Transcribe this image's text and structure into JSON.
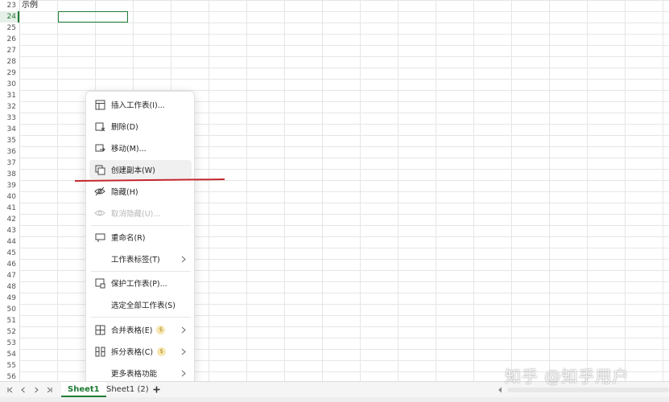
{
  "grid": {
    "rows": [
      "23",
      "24",
      "25",
      "26",
      "27",
      "28",
      "29",
      "30",
      "31",
      "32",
      "33",
      "34",
      "35",
      "36",
      "37",
      "38",
      "39",
      "40",
      "41",
      "42",
      "43",
      "44",
      "45",
      "46",
      "47",
      "48",
      "49",
      "50",
      "51",
      "52",
      "53",
      "54",
      "55",
      "56"
    ],
    "active_row": "24",
    "cell_a23_text": "示例"
  },
  "context_menu": {
    "items": [
      {
        "label": "插入工作表(I)...",
        "icon": "insert-sheet-icon"
      },
      {
        "label": "删除(D)",
        "icon": "delete-sheet-icon"
      },
      {
        "label": "移动(M)...",
        "icon": "move-sheet-icon"
      },
      {
        "label": "创建副本(W)",
        "icon": "copy-sheet-icon",
        "hovered": true
      },
      {
        "label": "隐藏(H)",
        "icon": "hide-eye-icon"
      },
      {
        "label": "取消隐藏(U)...",
        "icon": "unhide-eye-icon",
        "disabled": true
      },
      {
        "label": "重命名(R)",
        "icon": "rename-icon"
      },
      {
        "label": "工作表标签(T)",
        "icon": "",
        "submenu": true
      },
      {
        "label": "保护工作表(P)...",
        "icon": "protect-sheet-icon"
      },
      {
        "label": "选定全部工作表(S)",
        "icon": ""
      },
      {
        "label": "合并表格(E)",
        "icon": "merge-table-icon",
        "premium": true,
        "submenu": true
      },
      {
        "label": "拆分表格(C)",
        "icon": "split-table-icon",
        "premium": true,
        "submenu": true
      },
      {
        "label": "更多表格功能",
        "icon": "",
        "submenu": true
      }
    ]
  },
  "sheet_tabs": {
    "tabs": [
      "Sheet1",
      "Sheet1 (2)"
    ],
    "active": "Sheet1",
    "add_label": "+"
  },
  "watermark": "知乎 @知乎用户",
  "colors": {
    "accent_green": "#1e7b34",
    "annotation_red": "#c4262e"
  }
}
